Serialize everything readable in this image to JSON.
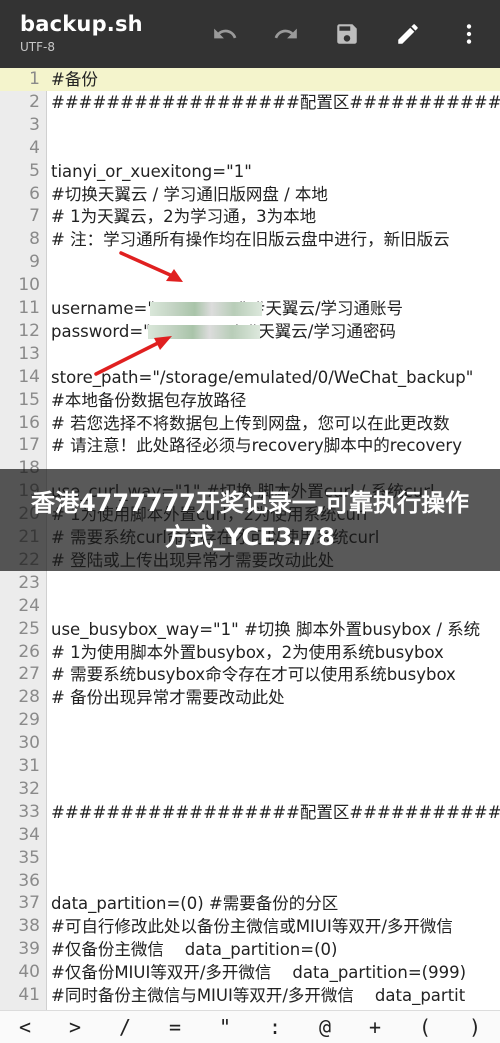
{
  "appbar": {
    "title": "backup.sh",
    "subtitle": "UTF-8",
    "icons": [
      "undo-icon",
      "redo-icon",
      "save-icon",
      "edit-icon",
      "more-vert-icon"
    ]
  },
  "lines": [
    {
      "n": "1",
      "t": "#备份"
    },
    {
      "n": "2",
      "t": "##################配置区#################"
    },
    {
      "n": "3",
      "t": ""
    },
    {
      "n": "4",
      "t": ""
    },
    {
      "n": "5",
      "t": "tianyi_or_xuexitong=\"1\""
    },
    {
      "n": "6",
      "t": "#切换天翼云 / 学习通旧版网盘 / 本地"
    },
    {
      "n": "7",
      "t": "# 1为天翼云，2为学习通，3为本地"
    },
    {
      "n": "8",
      "t": "# 注：学习通所有操作均在旧版云盘中进行，新旧版云"
    },
    {
      "n": "9",
      "t": ""
    },
    {
      "n": "10",
      "t": ""
    },
    {
      "n": "11",
      "t": "username=\"                \" #天翼云/学习通账号"
    },
    {
      "n": "12",
      "t": "password=\"                ' #天翼云/学习通密码"
    },
    {
      "n": "13",
      "t": ""
    },
    {
      "n": "14",
      "t": "store_path=\"/storage/emulated/0/WeChat_backup\""
    },
    {
      "n": "15",
      "t": "#本地备份数据包存放路径"
    },
    {
      "n": "16",
      "t": "# 若您选择不将数据包上传到网盘，您可以在此更改数"
    },
    {
      "n": "17",
      "t": "# 请注意！此处路径必须与recovery脚本中的recovery"
    },
    {
      "n": "18",
      "t": ""
    },
    {
      "n": "19",
      "t": "use_curl_way=\"1\" #切换 脚本外置curl / 系统curl"
    },
    {
      "n": "20",
      "t": "# 1为使用脚本外置curl，2为使用系统curl"
    },
    {
      "n": "21",
      "t": "# 需要系统curl命令存在才可以使用系统curl"
    },
    {
      "n": "22",
      "t": "# 登陆或上传出现异常才需要改动此处"
    },
    {
      "n": "23",
      "t": ""
    },
    {
      "n": "24",
      "t": ""
    },
    {
      "n": "25",
      "t": "use_busybox_way=\"1\" #切换 脚本外置busybox / 系统"
    },
    {
      "n": "26",
      "t": "# 1为使用脚本外置busybox，2为使用系统busybox"
    },
    {
      "n": "27",
      "t": "# 需要系统busybox命令存在才可以使用系统busybox"
    },
    {
      "n": "28",
      "t": "# 备份出现异常才需要改动此处"
    },
    {
      "n": "29",
      "t": ""
    },
    {
      "n": "30",
      "t": ""
    },
    {
      "n": "31",
      "t": ""
    },
    {
      "n": "32",
      "t": ""
    },
    {
      "n": "33",
      "t": "##################配置区#################"
    },
    {
      "n": "34",
      "t": ""
    },
    {
      "n": "35",
      "t": ""
    },
    {
      "n": "36",
      "t": ""
    },
    {
      "n": "37",
      "t": "data_partition=(0) #需要备份的分区"
    },
    {
      "n": "38",
      "t": "#可自行修改此处以备份主微信或MIUI等双开/多开微信"
    },
    {
      "n": "39",
      "t": "#仅备份主微信    data_partition=(0)"
    },
    {
      "n": "40",
      "t": "#仅备份MIUI等双开/多开微信    data_partition=(999)"
    },
    {
      "n": "41",
      "t": "#同时备份主微信与MIUI等双开/多开微信    data_partit"
    }
  ],
  "banner": {
    "text": "香港4777777开奖记录一,可靠执行操作方式_YCE3.78"
  },
  "symbols": [
    "<",
    ">",
    "/",
    "=",
    "\"",
    ":",
    "@",
    "+",
    "(",
    ")"
  ]
}
